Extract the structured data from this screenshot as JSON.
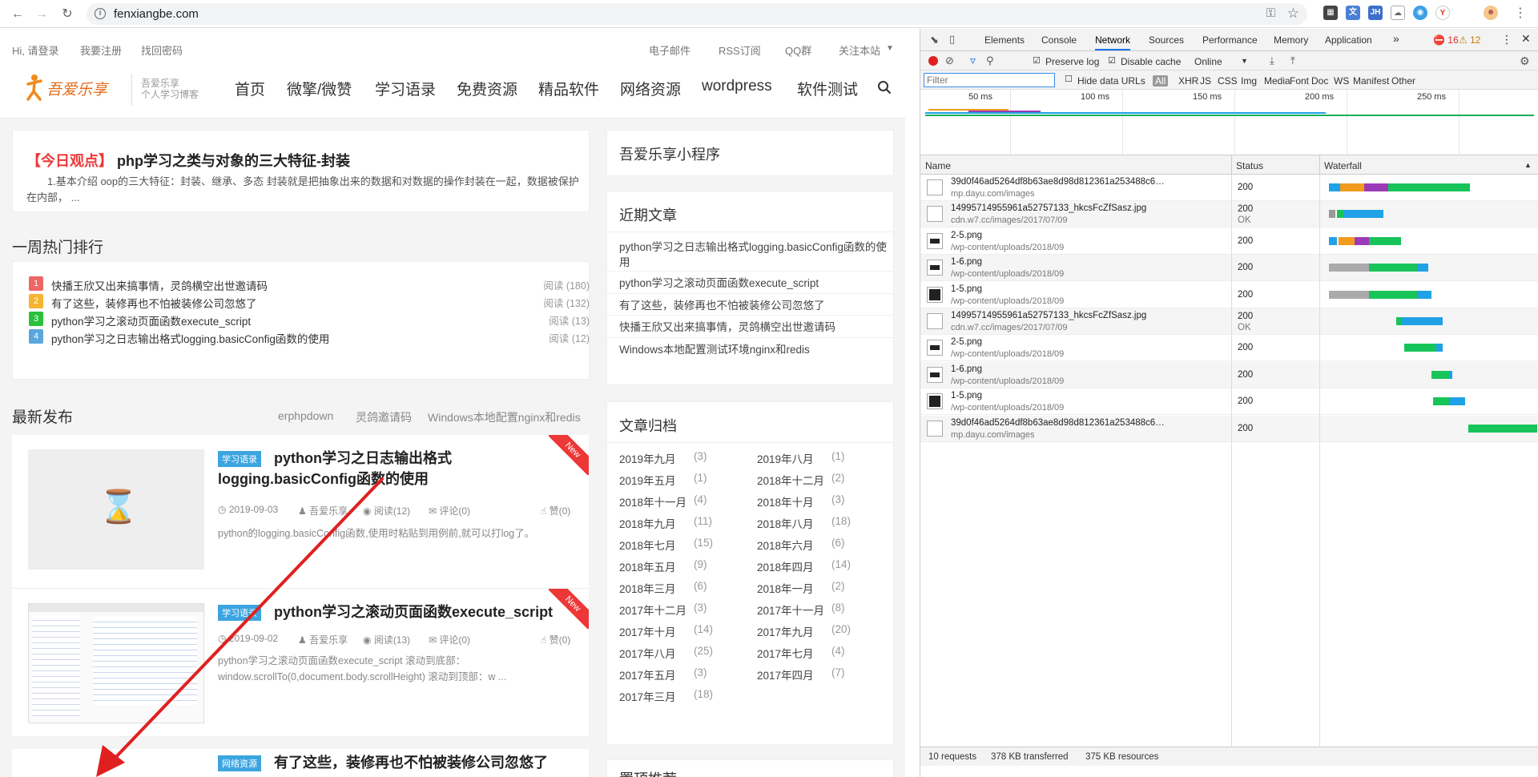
{
  "browser": {
    "url": "fenxiangbe.com",
    "icons": [
      "back-icon",
      "forward-icon",
      "reload-icon",
      "info-icon",
      "key-icon",
      "star-icon"
    ]
  },
  "site": {
    "topbar": {
      "greeting": "Hi, 请登录",
      "register": "我要注册",
      "recover": "找回密码",
      "links": [
        "电子邮件",
        "RSS订阅",
        "QQ群",
        "关注本站"
      ]
    },
    "logo": {
      "text": "吾爱乐享",
      "slogan1": "吾爱乐享",
      "slogan2": "个人学习博客"
    },
    "nav": [
      "首页",
      "微擎/微赞",
      "学习语录",
      "免费资源",
      "精品软件",
      "网络资源",
      "wordpress",
      "软件测试"
    ],
    "today": {
      "tag": "【今日观点】",
      "title": "php学习之类与对象的三大特征-封装",
      "excerpt": "1.基本介绍 oop的三大特征：封装、继承、多态 封装就是把抽象出来的数据和对数据的操作封装在一起，数据被保护在内部， ..."
    },
    "hot": {
      "title": "一周热门排行",
      "items": [
        {
          "num": "1",
          "title": "快播王欣又出来搞事情，灵鸽横空出世邀请码",
          "reads": "阅读 (180)",
          "color": "#ee6565"
        },
        {
          "num": "2",
          "title": "有了这些，装修再也不怕被装修公司忽悠了",
          "reads": "阅读 (132)",
          "color": "#f5b431"
        },
        {
          "num": "3",
          "title": "python学习之滚动页面函数execute_script",
          "reads": "阅读 (13)",
          "color": "#2cc13d"
        },
        {
          "num": "4",
          "title": "python学习之日志输出格式logging.basicConfig函数的使用",
          "reads": "阅读 (12)",
          "color": "#5ba6dd"
        }
      ]
    },
    "latest": {
      "title": "最新发布",
      "links": [
        "erphpdown",
        "灵鸽邀请码",
        "Windows本地配置nginx和redis"
      ],
      "posts": [
        {
          "tag": "学习语录",
          "title": "python学习之日志输出格式logging.basicConfig函数的使用",
          "date": "2019-09-03",
          "author": "吾爱乐享",
          "reads": "阅读(12)",
          "comments": "评论(0)",
          "likes": "赞(0)",
          "excerpt": "python的logging.basicConfig函数,使用时粘贴到用例前,就可以打log了。",
          "ribbon": "New"
        },
        {
          "tag": "学习语录",
          "title": "python学习之滚动页面函数execute_script",
          "date": "2019-09-02",
          "author": "吾爱乐享",
          "reads": "阅读(13)",
          "comments": "评论(0)",
          "likes": "赞(0)",
          "excerpt": "python学习之滚动页面函数execute_script 滚动到底部：window.scrollTo(0,document.body.scrollHeight) 滚动到顶部：w ...",
          "ribbon": "New"
        },
        {
          "tag": "网络资源",
          "title": "有了这些，装修再也不怕被装修公司忽悠了"
        }
      ]
    },
    "sidebar": {
      "miniapp": "吾爱乐享小程序",
      "recent_title": "近期文章",
      "recent": [
        "python学习之日志输出格式logging.basicConfig函数的使用",
        "python学习之滚动页面函数execute_script",
        "有了这些，装修再也不怕被装修公司忽悠了",
        "快播王欣又出来搞事情，灵鸽横空出世邀请码",
        "Windows本地配置测试环境nginx和redis"
      ],
      "archive_title": "文章归档",
      "archive": [
        [
          "2019年九月",
          "(3)",
          "2019年八月",
          "(1)"
        ],
        [
          "2019年五月",
          "(1)",
          "2018年十二月",
          "(2)"
        ],
        [
          "2018年十一月",
          "(4)",
          "2018年十月",
          "(3)"
        ],
        [
          "2018年九月",
          "(11)",
          "2018年八月",
          "(18)"
        ],
        [
          "2018年七月",
          "(15)",
          "2018年六月",
          "(6)"
        ],
        [
          "2018年五月",
          "(9)",
          "2018年四月",
          "(14)"
        ],
        [
          "2018年三月",
          "(6)",
          "2018年一月",
          "(2)"
        ],
        [
          "2017年十二月",
          "(3)",
          "2017年十一月",
          "(8)"
        ],
        [
          "2017年十月",
          "(14)",
          "2017年九月",
          "(20)"
        ],
        [
          "2017年八月",
          "(25)",
          "2017年七月",
          "(4)"
        ],
        [
          "2017年五月",
          "(3)",
          "2017年四月",
          "(7)"
        ],
        [
          "2017年三月",
          "(18)",
          "",
          ""
        ]
      ],
      "sticky_title": "置顶推荐"
    }
  },
  "devtools": {
    "tabs": [
      "Elements",
      "Console",
      "Network",
      "Sources",
      "Performance",
      "Memory",
      "Application"
    ],
    "active_tab": "Network",
    "more": "»",
    "errors": "16",
    "warnings": "12",
    "preserve_log": "Preserve log",
    "disable_cache": "Disable cache",
    "throttle": "Online",
    "filter_placeholder": "Filter",
    "hide_data_urls": "Hide data URLs",
    "types": [
      "All",
      "XHR",
      "JS",
      "CSS",
      "Img",
      "Media",
      "Font",
      "Doc",
      "WS",
      "Manifest",
      "Other"
    ],
    "timeline_ticks": [
      "50 ms",
      "100 ms",
      "150 ms",
      "200 ms",
      "250 ms"
    ],
    "columns": [
      "Name",
      "Status",
      "Waterfall"
    ],
    "requests": [
      {
        "name": "39d0f46ad5264df8b63ae8d98d812361a253488c644cc42304...3...",
        "domain": "mp.dayu.com/images",
        "status": "200",
        "status2": "",
        "thumb": "blank"
      },
      {
        "name": "14995714955961a52757133_hkcsFcZfSasz.jpg",
        "domain": "cdn.w7.cc/images/2017/07/09",
        "status": "200",
        "status2": "OK",
        "thumb": "blank"
      },
      {
        "name": "2-5.png",
        "domain": "/wp-content/uploads/2018/09",
        "status": "200",
        "status2": "",
        "thumb": "bar"
      },
      {
        "name": "1-6.png",
        "domain": "/wp-content/uploads/2018/09",
        "status": "200",
        "status2": "",
        "thumb": "bar"
      },
      {
        "name": "1-5.png",
        "domain": "/wp-content/uploads/2018/09",
        "status": "200",
        "status2": "",
        "thumb": "dark"
      },
      {
        "name": "14995714955961a52757133_hkcsFcZfSasz.jpg",
        "domain": "cdn.w7.cc/images/2017/07/09",
        "status": "200",
        "status2": "OK",
        "thumb": "blank"
      },
      {
        "name": "2-5.png",
        "domain": "/wp-content/uploads/2018/09",
        "status": "200",
        "status2": "",
        "thumb": "bar"
      },
      {
        "name": "1-6.png",
        "domain": "/wp-content/uploads/2018/09",
        "status": "200",
        "status2": "",
        "thumb": "bar"
      },
      {
        "name": "1-5.png",
        "domain": "/wp-content/uploads/2018/09",
        "status": "200",
        "status2": "",
        "thumb": "dark"
      },
      {
        "name": "39d0f46ad5264df8b63ae8d98d812361a253488c644cc42304...3...",
        "domain": "mp.dayu.com/images",
        "status": "200",
        "status2": "",
        "thumb": "blank"
      }
    ],
    "summary": {
      "requests": "10 requests",
      "transferred": "378 KB transferred",
      "resources": "375 KB resources"
    }
  }
}
